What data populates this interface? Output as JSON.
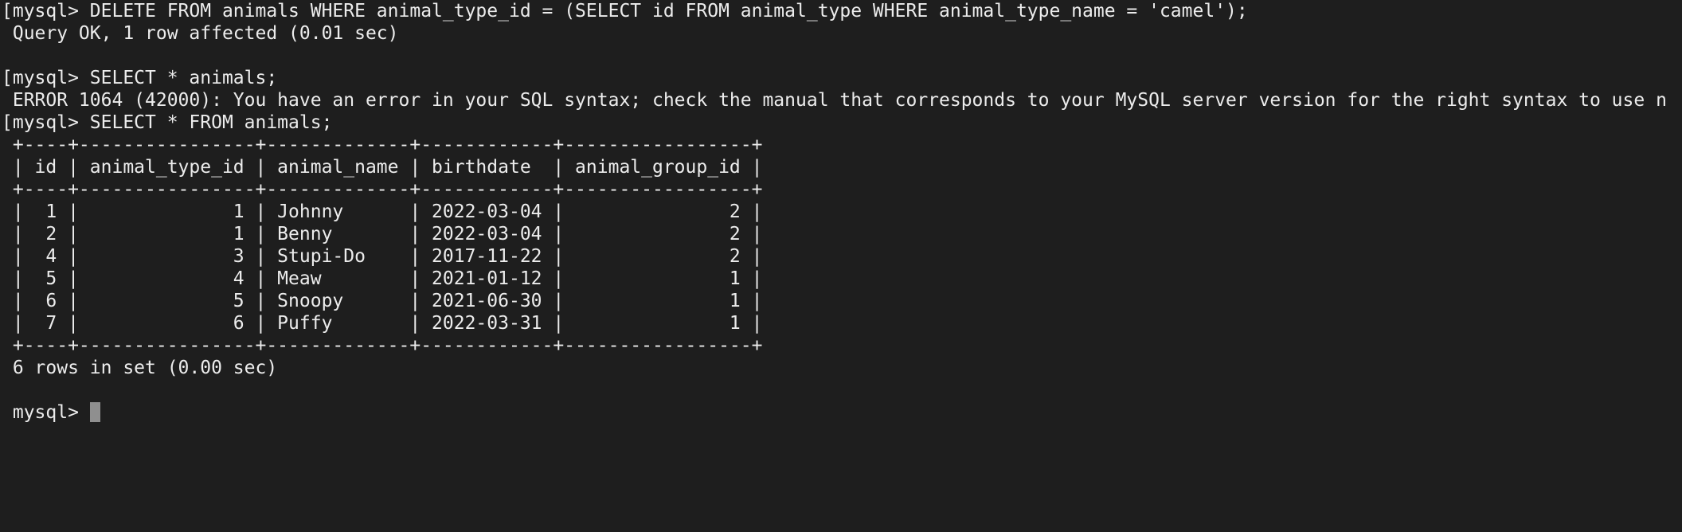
{
  "terminal": {
    "lines": [
      "[mysql> DELETE FROM animals WHERE animal_type_id = (SELECT id FROM animal_type WHERE animal_type_name = 'camel');",
      " Query OK, 1 row affected (0.01 sec)",
      "",
      "[mysql> SELECT * animals;",
      " ERROR 1064 (42000): You have an error in your SQL syntax; check the manual that corresponds to your MySQL server version for the right syntax to use n",
      "[mysql> SELECT * FROM animals;",
      " +----+----------------+-------------+------------+-----------------+",
      " | id | animal_type_id | animal_name | birthdate  | animal_group_id |",
      " +----+----------------+-------------+------------+-----------------+",
      " |  1 |              1 | Johnny      | 2022-03-04 |               2 |",
      " |  2 |              1 | Benny       | 2022-03-04 |               2 |",
      " |  4 |              3 | Stupi-Do    | 2017-11-22 |               2 |",
      " |  5 |              4 | Meaw        | 2021-01-12 |               1 |",
      " |  6 |              5 | Snoopy      | 2021-06-30 |               1 |",
      " |  7 |              6 | Puffy       | 2022-03-31 |               1 |",
      " +----+----------------+-------------+------------+-----------------+",
      " 6 rows in set (0.00 sec)",
      ""
    ],
    "prompt": " mysql> "
  },
  "colors": {
    "background": "#1e1e1e",
    "foreground": "#ececec",
    "cursor": "#8f8f8f"
  }
}
